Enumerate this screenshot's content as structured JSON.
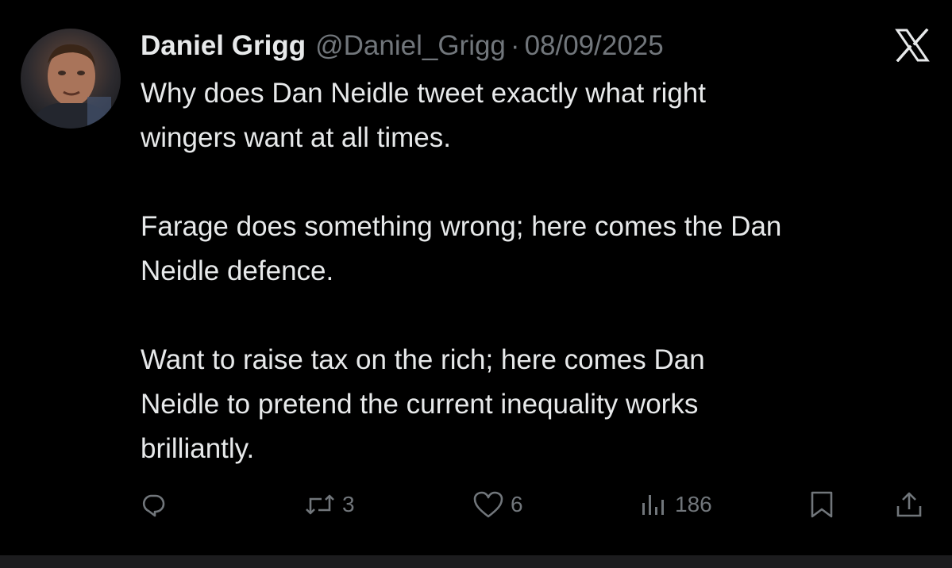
{
  "tweet": {
    "author": {
      "display_name": "Daniel Grigg",
      "handle": "@Daniel_Grigg",
      "avatar_icon": "avatar-photo"
    },
    "separator": "·",
    "date": "08/09/2025",
    "paragraphs": [
      "Why does Dan Neidle tweet exactly what right\nwingers want at all times.",
      "Farage does something wrong; here comes the Dan\nNeidle defence.",
      "Want to raise tax on the rich; here comes Dan\nNeidle to pretend the current inequality works\nbrilliantly."
    ],
    "actions": {
      "reply": {
        "icon": "reply-icon",
        "count": ""
      },
      "repost": {
        "icon": "repost-icon",
        "count": "3"
      },
      "like": {
        "icon": "heart-icon",
        "count": "6"
      },
      "views": {
        "icon": "views-icon",
        "count": "186"
      },
      "bookmark": {
        "icon": "bookmark-icon"
      },
      "share": {
        "icon": "share-icon"
      }
    }
  },
  "brand": {
    "logo": "x-logo-icon"
  },
  "colors": {
    "background": "#000000",
    "text_primary": "#e7e9ea",
    "text_secondary": "#71767b"
  }
}
